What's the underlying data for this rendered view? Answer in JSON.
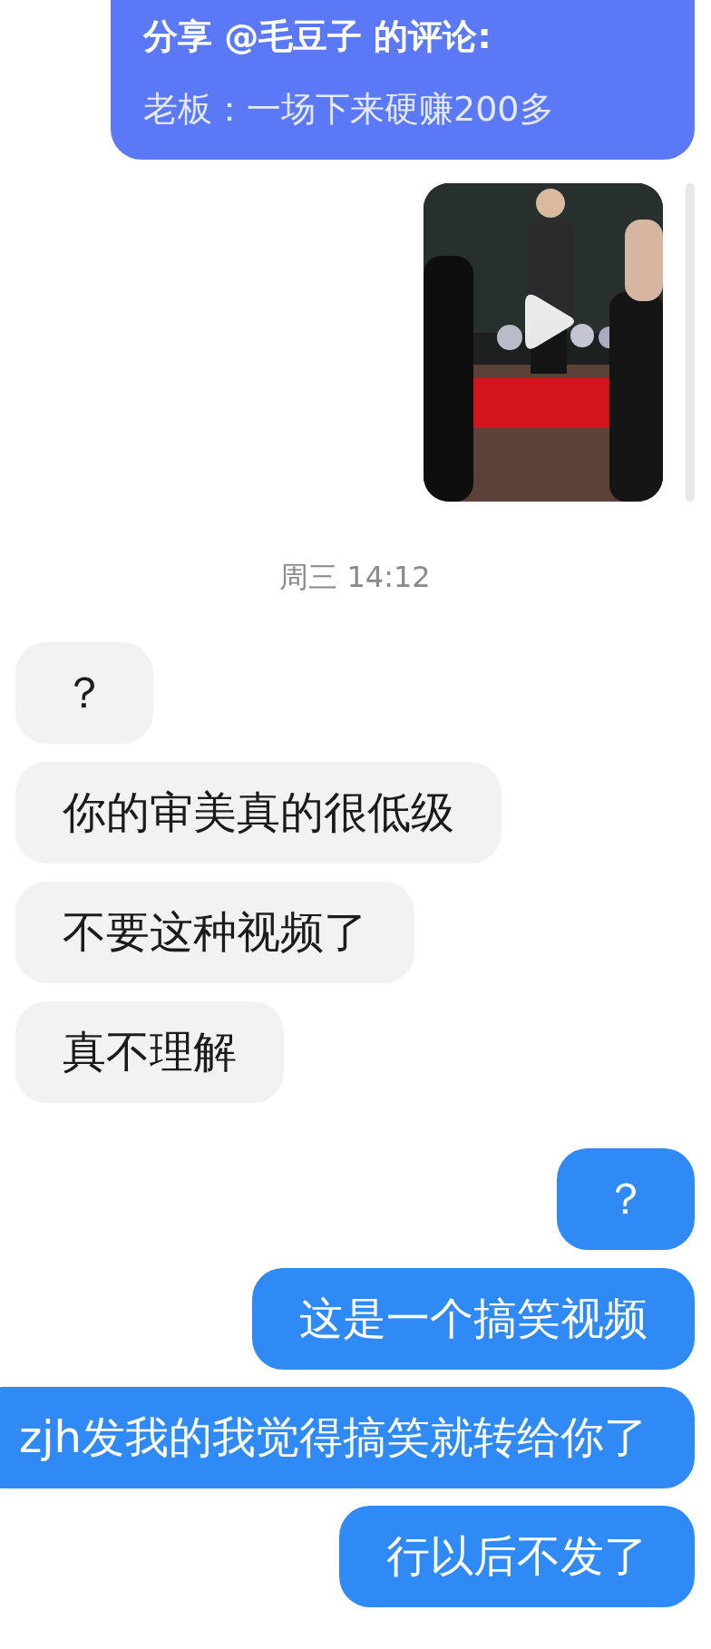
{
  "messages": [
    {
      "kind": "share",
      "outgoing": true,
      "title": "分享 @毛豆子 的评论:",
      "text": "老板：一场下来硬赚200多"
    },
    {
      "kind": "video",
      "outgoing": true
    },
    {
      "kind": "time",
      "text": "周三 14:12"
    },
    {
      "kind": "text",
      "outgoing": false,
      "text": "？"
    },
    {
      "kind": "text",
      "outgoing": false,
      "text": "你的审美真的很低级"
    },
    {
      "kind": "text",
      "outgoing": false,
      "text": "不要这种视频了"
    },
    {
      "kind": "text",
      "outgoing": false,
      "text": "真不理解"
    },
    {
      "kind": "text",
      "outgoing": true,
      "text": "？"
    },
    {
      "kind": "text",
      "outgoing": true,
      "text": "这是一个搞笑视频"
    },
    {
      "kind": "text",
      "outgoing": true,
      "text": "zjh发我的我觉得搞笑就转给你了"
    },
    {
      "kind": "text",
      "outgoing": true,
      "text": "行以后不发了"
    }
  ]
}
